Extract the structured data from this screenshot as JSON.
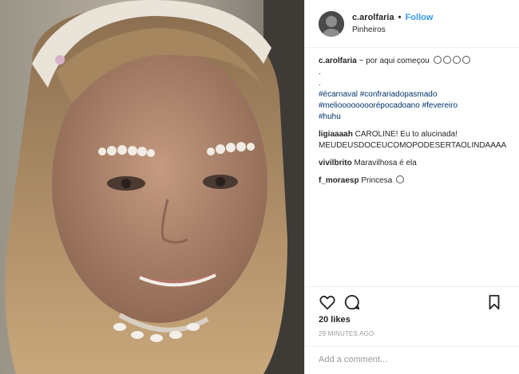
{
  "post": {
    "username": "c.arolfaria",
    "separator": "•",
    "follow_label": "Follow",
    "location": "Pinheiros"
  },
  "caption": {
    "username": "c.arolfaria",
    "text": "~ por aqui começou",
    "dot1": ".",
    "dot2": ".",
    "tags_line1_a": "#écarnaval",
    "tags_line1_b": "#confrariadopasmado",
    "tags_line2_a": "#melioooooooorépocadoano",
    "tags_line2_b": "#fevereiro",
    "tags_line3": "#huhu"
  },
  "comments": [
    {
      "username": "ligiaaaah",
      "text": "CAROLINE! Eu to alucinada! MEUDEUSDOCEUCOMOPODESERTAOLINDAAAA"
    },
    {
      "username": "vivilbrito",
      "text": "Maravilhosa é ela"
    },
    {
      "username": "f_moraesp",
      "text": "Princesa"
    }
  ],
  "likes": "20 likes",
  "timestamp": "29 MINUTES AGO",
  "add_comment_placeholder": "Add a comment...",
  "icons": [
    "heart-icon",
    "comment-icon",
    "bookmark-icon"
  ]
}
